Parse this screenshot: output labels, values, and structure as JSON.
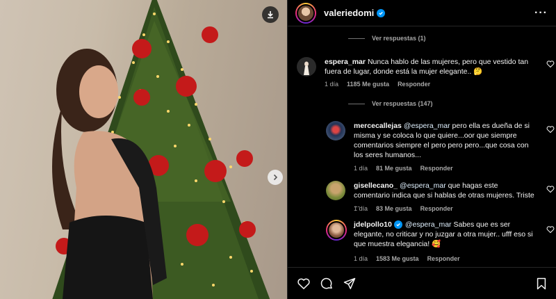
{
  "header": {
    "username": "valeriedomi",
    "verified_icon": "verified-badge-icon",
    "more_icon": "more-options-icon"
  },
  "comments": [
    {
      "view_replies": "Ver respuestas (1)"
    },
    {
      "username": "espera_mar",
      "text": "Nunca hablo de las mujeres, pero que vestido tan fuera de lugar, donde está la mujer elegante..",
      "emoji": "🤔",
      "time": "1 día",
      "likes": "1185 Me gusta",
      "reply": "Responder",
      "view_replies": "Ver respuestas (147)"
    }
  ],
  "replies": [
    {
      "username": "mercecallejas",
      "mention": "@espera_mar",
      "text": "pero ella es dueña de si misma y se coloca lo que quiere...oor que siempre comentarios siempre el pero pero pero...que cosa con los seres humanos...",
      "time": "1 día",
      "likes": "81 Me gusta",
      "reply": "Responder"
    },
    {
      "username": "gisellecano_",
      "mention": "@espera_mar",
      "text": "que hagas este comentario indica que si hablas de otras mujeres. Triste ...",
      "time": "1 día",
      "likes": "83 Me gusta",
      "reply": "Responder"
    },
    {
      "username": "jdelpollo10",
      "verified": true,
      "mention": "@espera_mar",
      "text": "Sabes que es ser elegante, no criticar y no juzgar a otra mujer.. ufff eso si que muestra elegancia!",
      "emoji": "🥰",
      "time": "1 día",
      "likes": "1583 Me gusta",
      "reply": "Responder"
    }
  ],
  "actions": {
    "like_icon": "heart-icon",
    "comment_icon": "comment-icon",
    "share_icon": "send-icon",
    "save_icon": "bookmark-icon"
  },
  "colors": {
    "background": "#000000",
    "text": "#f5f5f5",
    "secondary_text": "#a8a8a8",
    "verified_blue": "#0095f6",
    "border": "#262626"
  }
}
